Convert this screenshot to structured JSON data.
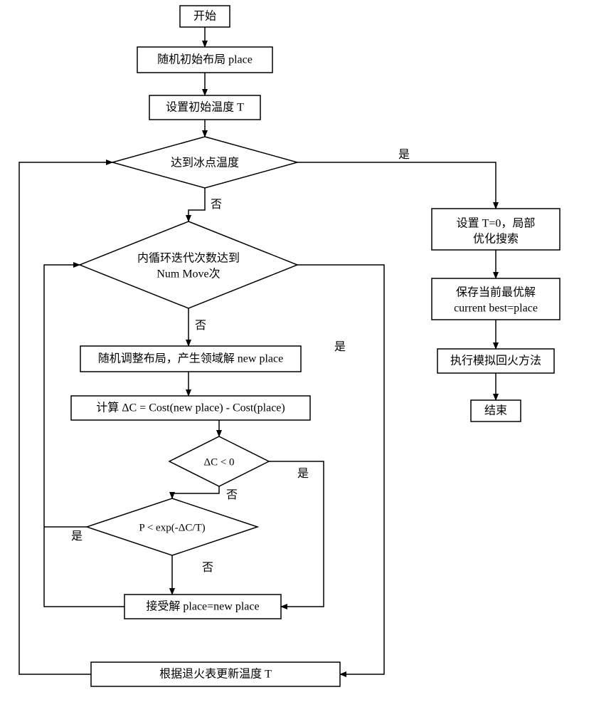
{
  "nodes": {
    "start": "开始",
    "init": "随机初始布局 place",
    "setT": "设置初始温度 T",
    "freeze": "达到冰点温度",
    "inner_l1": "内循环迭代次数达到",
    "inner_l2": "Num Move次",
    "randAdj": "随机调整布局，产生领域解 new place",
    "deltaC": "计算 ΔC = Cost(new place) - Cost(place)",
    "dcLt0": "ΔC < 0",
    "probTest": "P < exp(-ΔC/T)",
    "accept": "接受解 place=new place",
    "updateT": "根据退火表更新温度 T",
    "setT0_l1": "设置 T=0，局部",
    "setT0_l2": "优化搜索",
    "save_l1": "保存当前最优解",
    "save_l2": "current best=place",
    "reheat": "执行模拟回火方法",
    "end": "结束"
  },
  "edges": {
    "yes": "是",
    "no": "否"
  }
}
